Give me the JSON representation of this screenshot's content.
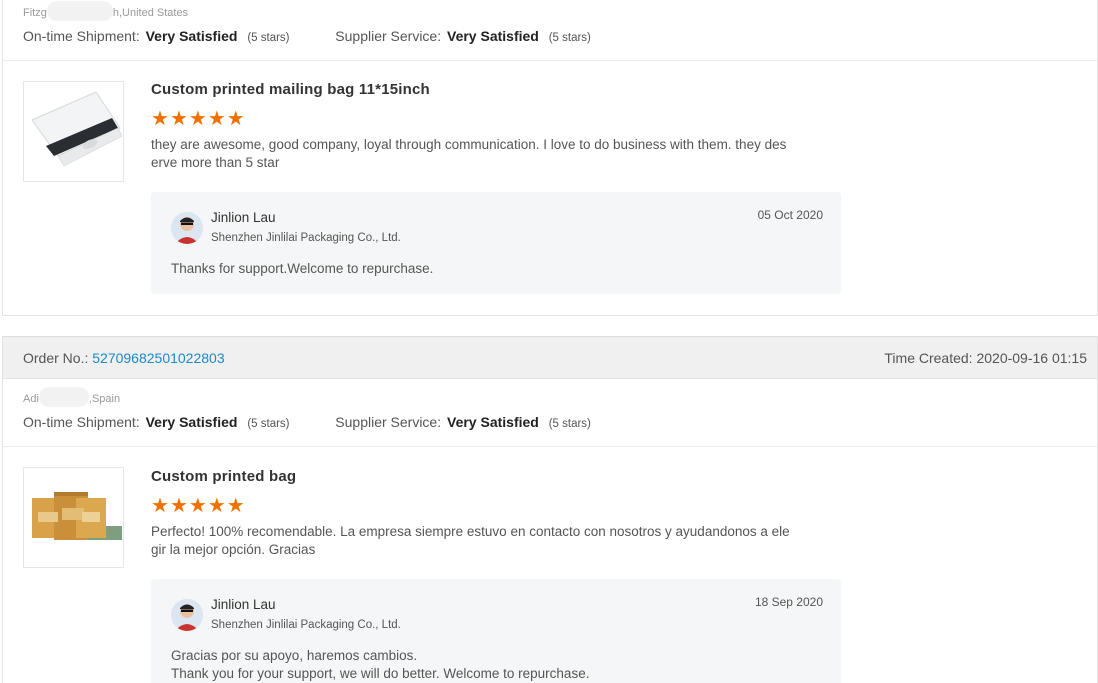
{
  "reviews": [
    {
      "buyer_location_prefix": "Fitzg",
      "buyer_location_suffix": "h,United States",
      "shipment_label": "On-time Shipment:",
      "shipment_value": "Very Satisfied",
      "shipment_stars": "(5 stars)",
      "service_label": "Supplier Service:",
      "service_value": "Very Satisfied",
      "service_stars": "(5 stars)",
      "product_title": "Custom printed mailing bag 11*15inch",
      "rating": 5,
      "text": "they are awesome, good company, loyal through communication. I love to do business with them. they des erve more than 5 star",
      "reply": {
        "name": "Jinlion Lau",
        "company": "Shenzhen Jinlilai Packaging Co., Ltd.",
        "date": "05 Oct 2020",
        "message": "Thanks for support.Welcome to repurchase."
      }
    },
    {
      "order_label": "Order No.:",
      "order_no": "52709682501022803",
      "time_created": "Time Created: 2020-09-16 01:15",
      "buyer_location_prefix": "Adi",
      "buyer_location_suffix": ",Spain",
      "shipment_label": "On-time Shipment:",
      "shipment_value": "Very Satisfied",
      "shipment_stars": "(5 stars)",
      "service_label": "Supplier Service:",
      "service_value": "Very Satisfied",
      "service_stars": "(5 stars)",
      "product_title": "Custom printed bag",
      "rating": 5,
      "text": "Perfecto! 100% recomendable. La empresa siempre estuvo en contacto con nosotros y ayudandonos a ele gir la mejor opción. Gracias",
      "reply": {
        "name": "Jinlion Lau",
        "company": "Shenzhen Jinlilai Packaging Co., Ltd.",
        "date": "18 Sep 2020",
        "message": "Gracias por su apoyo, haremos cambios.\nThank you for your support, we will do better. Welcome to repurchase."
      }
    }
  ],
  "colors": {
    "star": "#f07100",
    "link": "#1a8ac9",
    "header_bg": "#f0f0f0",
    "reply_bg": "#f5f6f7"
  },
  "icons": {
    "star": "star-icon",
    "avatar": "avatar"
  }
}
